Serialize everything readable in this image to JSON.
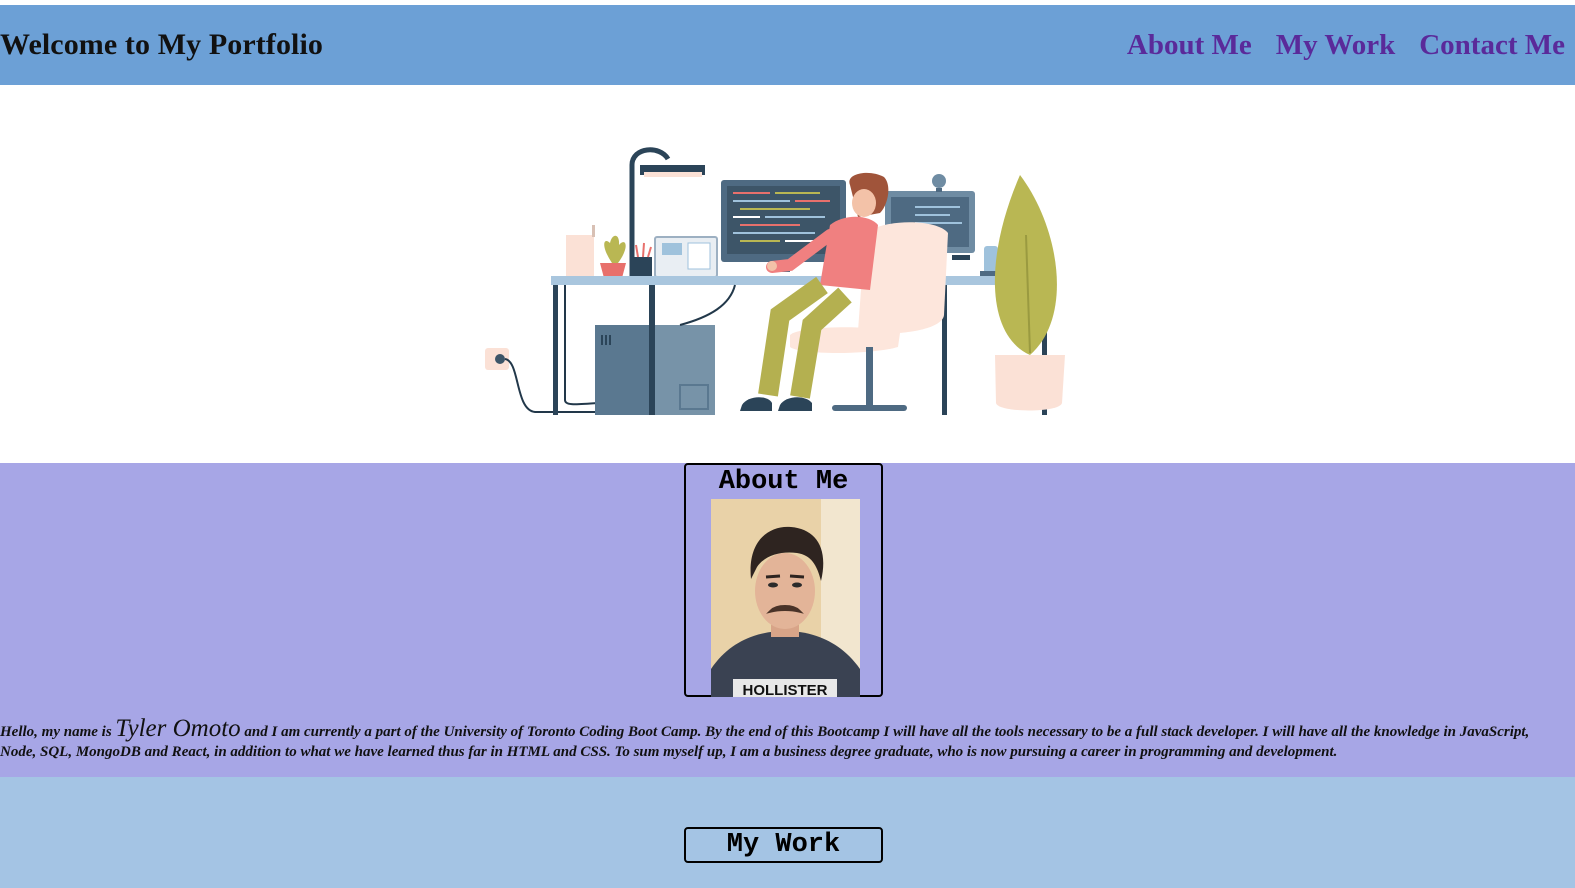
{
  "header": {
    "title": "Welcome to My Portfolio",
    "nav": [
      {
        "label": "About Me"
      },
      {
        "label": "My Work"
      },
      {
        "label": "Contact Me"
      }
    ]
  },
  "hero": {
    "image": "developer-at-desk-illustration"
  },
  "about": {
    "heading": "About Me",
    "photo": "profile-photo",
    "shirt_text": "HOLLISTER",
    "bio_prefix": "Hello, my name is",
    "name": "Tyler Omoto",
    "bio_rest": "and I am currently a part of the University of Toronto Coding Boot Camp. By the end of this Bootcamp I will have all the tools necessary to be a full stack developer. I will have all the knowledge in JavaScript, Node, SQL, MongoDB and React, in addition to what we have learned thus far in HTML and CSS. To sum myself up, I am a business degree graduate, who is now pursuing a career in programming and development."
  },
  "work": {
    "heading": "My Work"
  },
  "colors": {
    "header_bg": "#6ca0d6",
    "nav_link": "#5a2a9a",
    "about_bg": "#a7a6e6",
    "work_bg": "#a4c4e4"
  }
}
